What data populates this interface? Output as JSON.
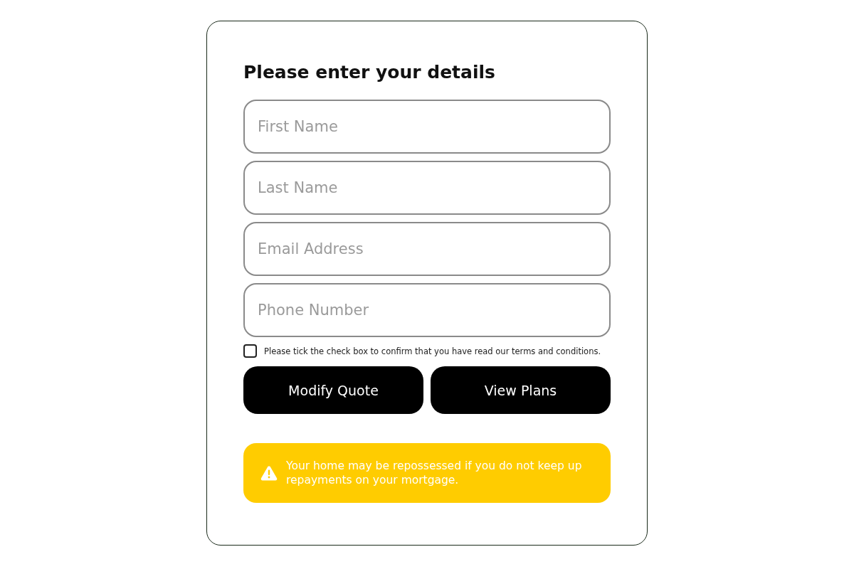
{
  "form": {
    "title": "Please enter your details",
    "fields": [
      {
        "placeholder": "First Name"
      },
      {
        "placeholder": "Last Name"
      },
      {
        "placeholder": "Email Address"
      },
      {
        "placeholder": "Phone Number"
      }
    ],
    "consent": {
      "label": "Please tick the check box to confirm that you have read our terms and conditions.",
      "checked": false
    },
    "buttons": [
      "Modify Quote",
      "View Plans"
    ],
    "warning": "Your home may be repossessed if you do not keep up repayments on your mortgage."
  }
}
